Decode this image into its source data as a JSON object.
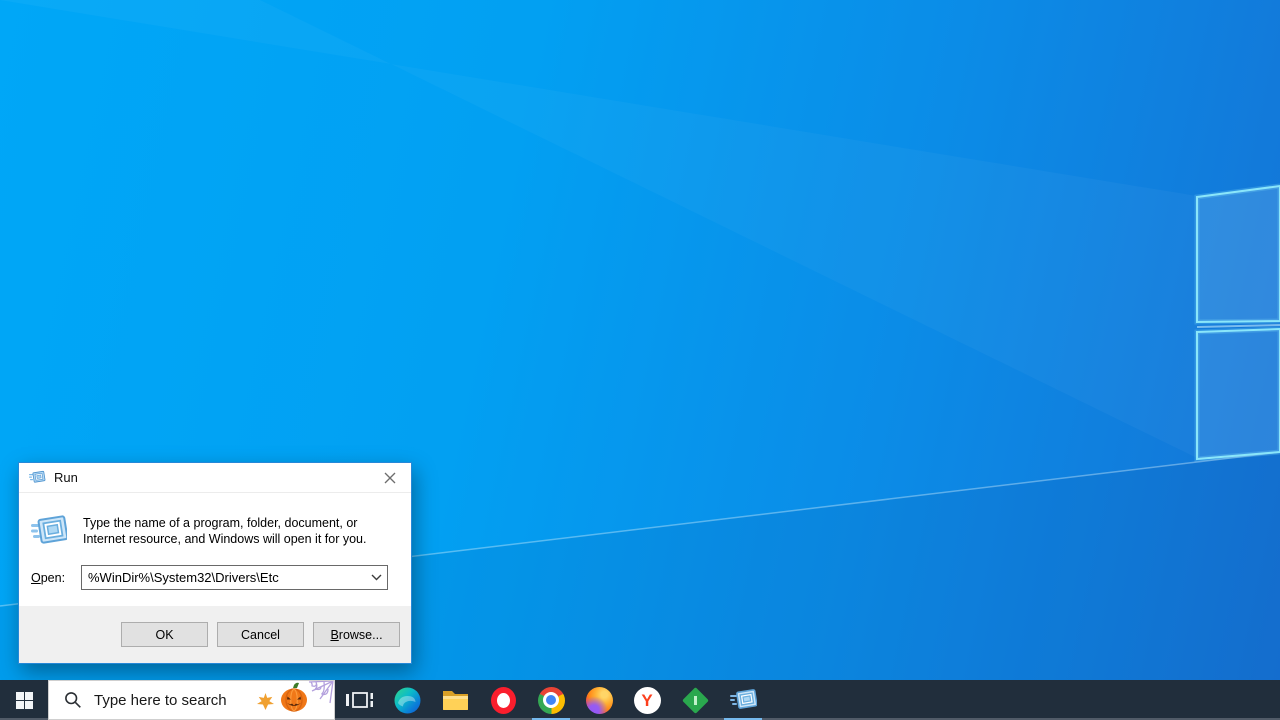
{
  "run_dialog": {
    "title": "Run",
    "description": "Type the name of a program, folder, document, or Internet resource, and Windows will open it for you.",
    "open_label_prefix": "O",
    "open_label_rest": "pen:",
    "input_value": "%WinDir%\\System32\\Drivers\\Etc",
    "buttons": {
      "ok": "OK",
      "cancel": "Cancel",
      "browse_prefix": "B",
      "browse_rest": "rowse..."
    }
  },
  "taskbar": {
    "search_placeholder": "Type here to search",
    "yandex_glyph": "Y",
    "icons": [
      "start",
      "search",
      "halloween-leaf",
      "halloween-pumpkin",
      "halloween-spiderweb",
      "task-view",
      "edge",
      "file-explorer",
      "opera",
      "chrome",
      "firefox",
      "yandex-browser",
      "green-diamond-app",
      "run"
    ],
    "active_apps": [
      "chrome",
      "run"
    ]
  },
  "colors": {
    "wallpaper_top_left": "#00a6f6",
    "wallpaper_deep_right": "#1573d5",
    "logo_edge_glow": "#7fdcf7",
    "taskbar_bg": "#212e3c",
    "active_indicator": "#76b9ed",
    "dialog_border": "#2688d8",
    "dialog_footer_bg": "#f0f0f0",
    "button_bg": "#e1e1e1",
    "button_border": "#adadad"
  }
}
